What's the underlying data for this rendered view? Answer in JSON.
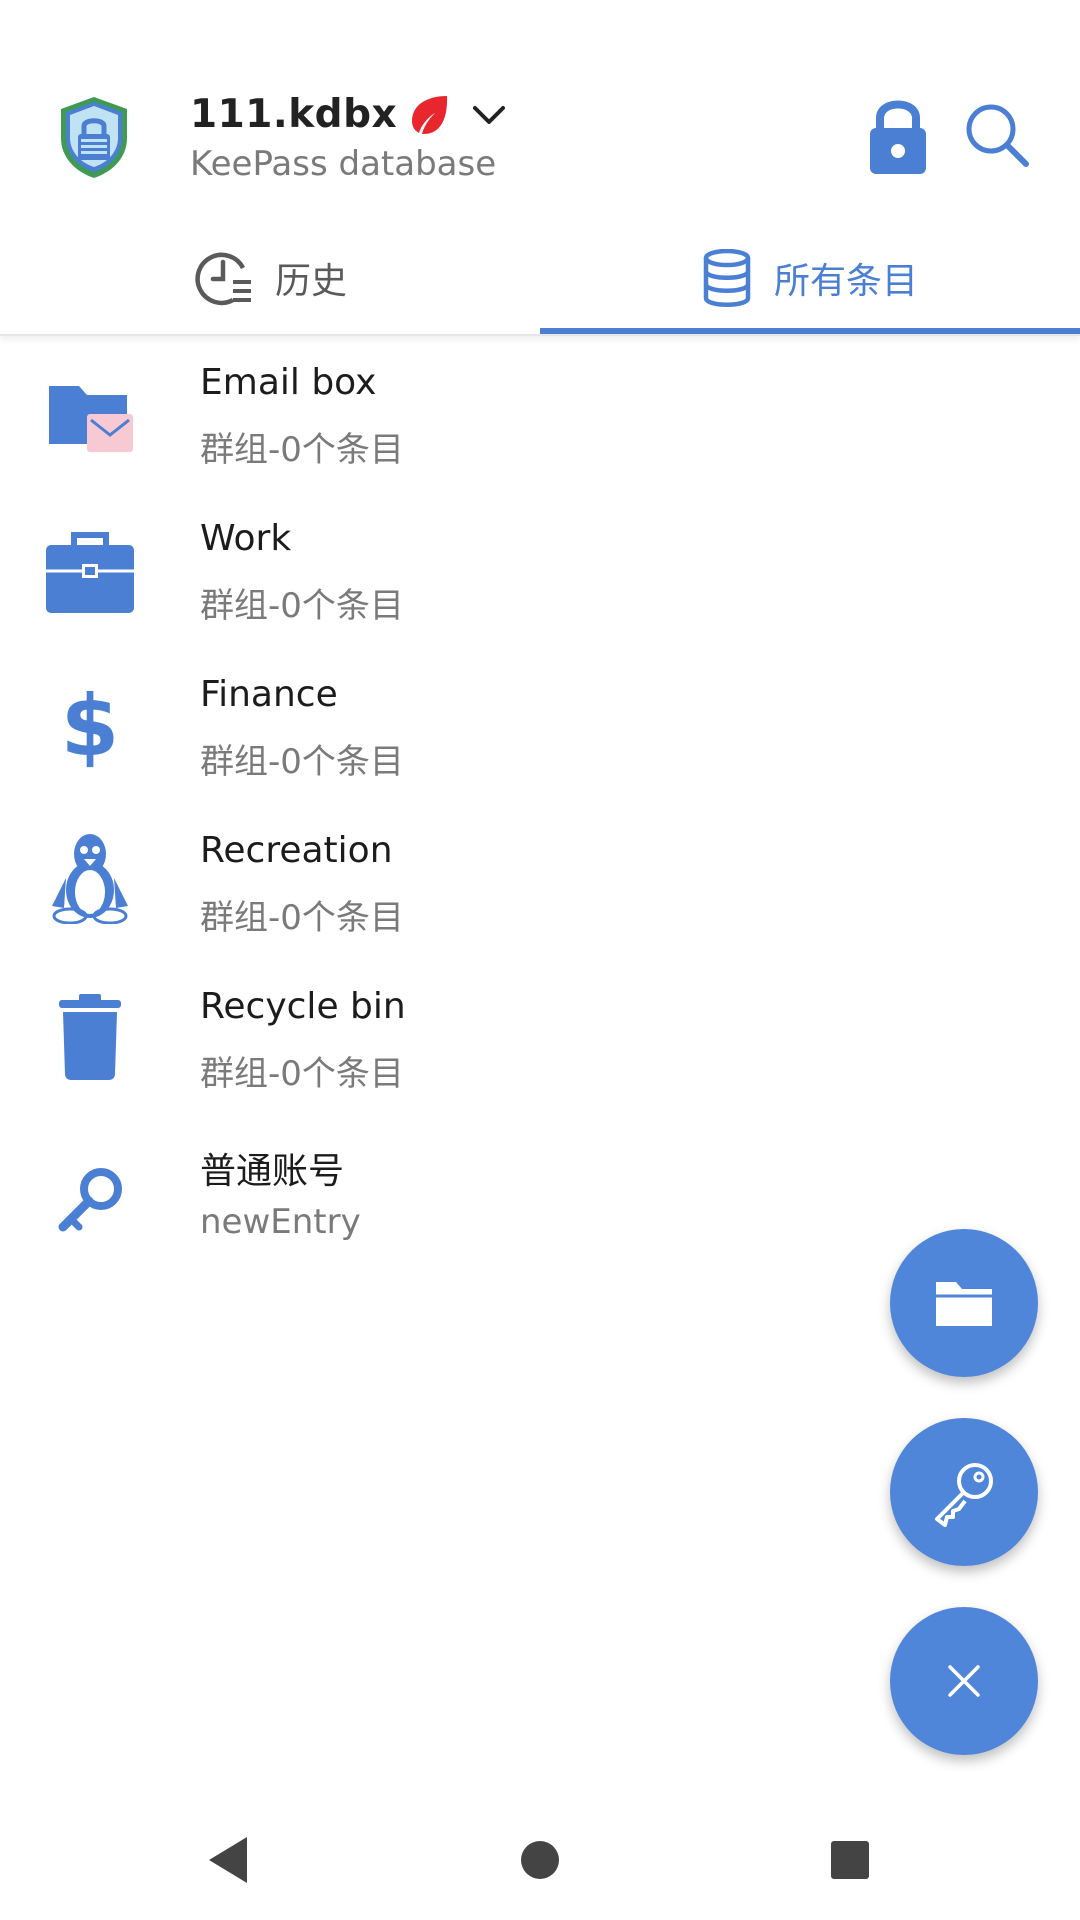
{
  "header": {
    "db_name": "111.kdbx",
    "db_subtitle": "KeePass database",
    "icons": [
      "app-shield-logo",
      "leaf-icon",
      "chevron-down-icon",
      "lock-icon",
      "search-icon"
    ]
  },
  "tabs": [
    {
      "label": "历史",
      "icon": "history-clock-icon",
      "selected": false
    },
    {
      "label": "所有条目",
      "icon": "database-icon",
      "selected": true
    }
  ],
  "list": [
    {
      "title": "Email box",
      "subtitle": "群组-0个条目",
      "icon": "email-folder-icon"
    },
    {
      "title": "Work",
      "subtitle": "群组-0个条目",
      "icon": "briefcase-icon"
    },
    {
      "title": "Finance",
      "subtitle": "群组-0个条目",
      "icon": "dollar-icon"
    },
    {
      "title": "Recreation",
      "subtitle": "群组-0个条目",
      "icon": "penguin-icon"
    },
    {
      "title": "Recycle bin",
      "subtitle": "群组-0个条目",
      "icon": "trash-icon"
    },
    {
      "title": "普通账号",
      "subtitle": "newEntry",
      "icon": "key-icon"
    }
  ],
  "fabs": [
    "add-group-icon",
    "add-entry-key-icon",
    "close-icon"
  ],
  "colors": {
    "accent": "#4a7fd4",
    "fab": "#4f86d9",
    "leaf": "#e8262d",
    "pink": "#f7c9d2"
  }
}
